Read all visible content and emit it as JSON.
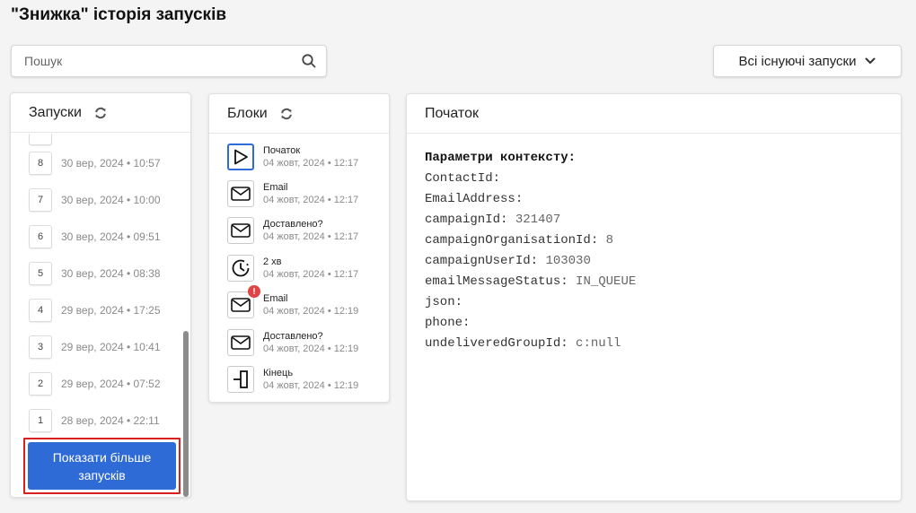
{
  "page": {
    "title": "\"Знижка\" історія запусків"
  },
  "search": {
    "placeholder": "Пошук"
  },
  "filter": {
    "label": "Всі існуючі запуски"
  },
  "runs": {
    "title": "Запуски",
    "items": [
      {
        "num": "8",
        "date": "30 вер, 2024 • 10:57"
      },
      {
        "num": "7",
        "date": "30 вер, 2024 • 10:00"
      },
      {
        "num": "6",
        "date": "30 вер, 2024 • 09:51"
      },
      {
        "num": "5",
        "date": "30 вер, 2024 • 08:38"
      },
      {
        "num": "4",
        "date": "29 вер, 2024 • 17:25"
      },
      {
        "num": "3",
        "date": "29 вер, 2024 • 10:41"
      },
      {
        "num": "2",
        "date": "29 вер, 2024 • 07:52"
      },
      {
        "num": "1",
        "date": "28 вер, 2024 • 22:11"
      }
    ],
    "more_label": "Показати більше запусків"
  },
  "blocks": {
    "title": "Блоки",
    "items": [
      {
        "name": "Початок",
        "date": "04 жовт, 2024 • 12:17",
        "icon": "play-icon"
      },
      {
        "name": "Email",
        "date": "04 жовт, 2024 • 12:17",
        "icon": "envelope-icon"
      },
      {
        "name": "Доставлено?",
        "date": "04 жовт, 2024 • 12:17",
        "icon": "envelope-icon"
      },
      {
        "name": "2 хв",
        "date": "04 жовт, 2024 • 12:17",
        "icon": "timer-icon"
      },
      {
        "name": "Email",
        "date": "04 жовт, 2024 • 12:19",
        "icon": "envelope-icon",
        "badge": "!"
      },
      {
        "name": "Доставлено?",
        "date": "04 жовт, 2024 • 12:19",
        "icon": "envelope-icon"
      },
      {
        "name": "Кінець",
        "date": "04 жовт, 2024 • 12:19",
        "icon": "end-icon"
      }
    ]
  },
  "detail": {
    "title": "Початок",
    "context_title": "Параметри контексту:",
    "params": [
      {
        "key": "ContactId:",
        "value": ""
      },
      {
        "key": "EmailAddress:",
        "value": ""
      },
      {
        "key": "campaignId:",
        "value": "321407"
      },
      {
        "key": "campaignOrganisationId:",
        "value": "8"
      },
      {
        "key": "campaignUserId:",
        "value": "103030"
      },
      {
        "key": "emailMessageStatus:",
        "value": "IN_QUEUE"
      },
      {
        "key": "json:",
        "value": ""
      },
      {
        "key": "phone:",
        "value": ""
      },
      {
        "key": "undeliveredGroupId:",
        "value": "c:null"
      }
    ]
  },
  "colors": {
    "accent": "#2f6bd6",
    "highlight": "#d92020",
    "error": "#e04444"
  }
}
